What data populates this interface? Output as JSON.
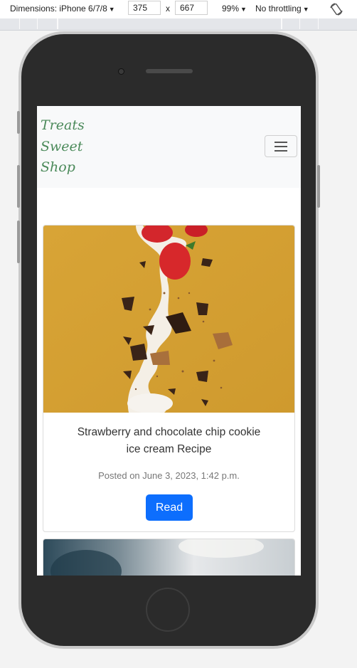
{
  "devtools": {
    "dimensions_label": "Dimensions: iPhone 6/7/8",
    "width": "375",
    "times": "x",
    "height": "667",
    "zoom": "99%",
    "throttling": "No throttling",
    "rotate_icon": "rotate-icon"
  },
  "navbar": {
    "brand_lines": [
      "Treats",
      "Sweet",
      "Shop"
    ],
    "toggler_icon": "hamburger-icon",
    "brand_color": "#4b8a5a"
  },
  "posts": [
    {
      "title_lines": [
        "Strawberry and chocolate chip cookie",
        "ice cream Recipe"
      ],
      "date": "Posted on June 3, 2023, 1:42 p.m.",
      "button_label": "Read"
    }
  ],
  "colors": {
    "button": "#0d6efd",
    "hero_background": "#d9a83a"
  }
}
